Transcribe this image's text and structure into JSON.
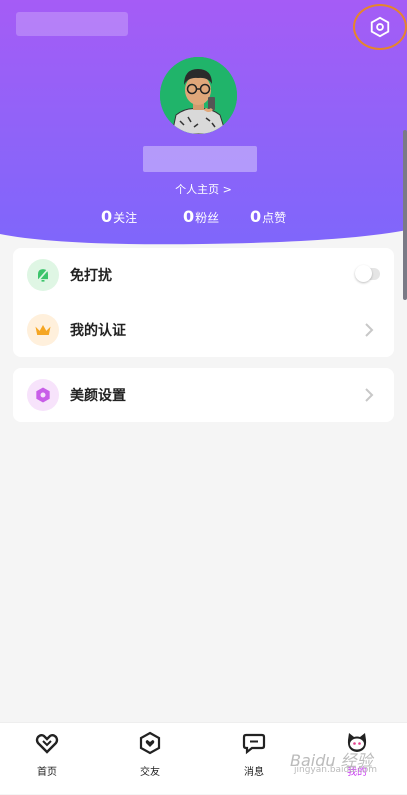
{
  "header": {
    "settings_icon": "gear-hexagon-icon",
    "profile_link": "个人主页 >",
    "stats": [
      {
        "num": "0",
        "label": "关注"
      },
      {
        "num": "0",
        "label": "粉丝"
      },
      {
        "num": "0",
        "label": "点赞"
      }
    ],
    "accent_colors": [
      "#a55cf6",
      "#7f66fb"
    ]
  },
  "menu": {
    "dnd": {
      "label": "免打扰",
      "icon": "bell-mute-icon",
      "enabled": false
    },
    "certify": {
      "label": "我的认证",
      "icon": "crown-icon"
    },
    "beauty": {
      "label": "美颜设置",
      "icon": "beauty-hexagon-icon"
    }
  },
  "tabs": [
    {
      "label": "首页",
      "icon": "heart-home-icon"
    },
    {
      "label": "交友",
      "icon": "heart-shield-icon"
    },
    {
      "label": "消息",
      "icon": "chat-icon"
    },
    {
      "label": "我的",
      "icon": "cat-face-icon",
      "active": true
    }
  ],
  "watermark": {
    "line1": "Baidu 经验",
    "line2": "jingyan.baidu.com"
  }
}
